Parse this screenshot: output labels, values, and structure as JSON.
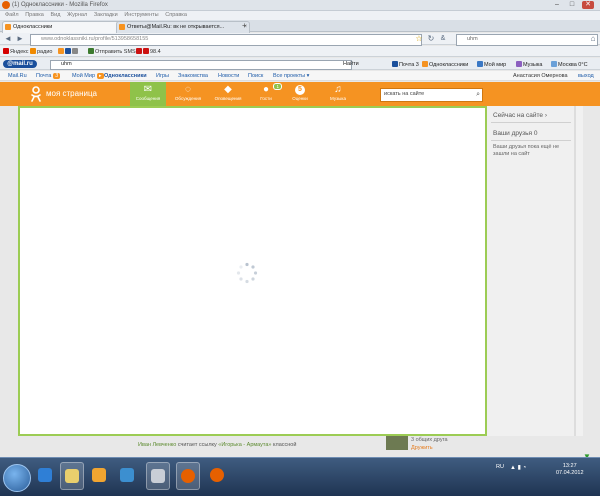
{
  "window": {
    "title": "(1) Одноклассники - Mozilla Firefox",
    "min_glyph": "–",
    "max_glyph": "□",
    "close_glyph": "✕"
  },
  "menu": [
    "Файл",
    "Правка",
    "Вид",
    "Журнал",
    "Закладки",
    "Инструменты",
    "Справка"
  ],
  "tabs": [
    {
      "label": "Одноклассники",
      "active": true
    },
    {
      "label": "Ответы@Mail.Ru: вк не открывается...",
      "active": false
    }
  ],
  "tab_add": "+",
  "nav": {
    "url": "www.odnoklassniki.ru/profile/513958658155",
    "search_value": "uhm",
    "back": "◄",
    "forward": "►",
    "reload": "↻"
  },
  "bookmarks": [
    {
      "label": "Яндекс",
      "color": "#d40000"
    },
    {
      "label": "радио",
      "color": "#f08a00"
    },
    {
      "label": "Отправить SMS",
      "color": "#3c7a2e"
    },
    {
      "label": "98.4",
      "color": "#c11"
    }
  ],
  "mailru": {
    "logo": "@mail.ru",
    "search_value": "uhm",
    "find": "Найти",
    "mail": "Почта 3",
    "ok": "Одноклассники",
    "myworld": "Мой мир",
    "music": "Музыка",
    "weather": "Москва 0°C"
  },
  "portal": {
    "items": [
      "Mail.Ru",
      "Почта",
      "Мой Мир",
      "Одноклассники",
      "Игры",
      "Знакомства",
      "Новости",
      "Поиск",
      "Все проекты ▾"
    ],
    "mail_count": "3",
    "user": "Анастасия Омернова",
    "logout": "выход"
  },
  "ok": {
    "title": "моя страница",
    "nav": [
      {
        "label": "Сообщения",
        "icon": "✉",
        "active": true,
        "badge": ""
      },
      {
        "label": "Обсуждения",
        "icon": "◌",
        "active": false,
        "badge": ""
      },
      {
        "label": "Оповещения",
        "icon": "◆",
        "active": false,
        "badge": ""
      },
      {
        "label": "Гости",
        "icon": "●",
        "active": false,
        "badge": "1"
      },
      {
        "label": "Оценки",
        "icon": "5",
        "active": false,
        "badge": ""
      },
      {
        "label": "Музыка",
        "icon": "♫",
        "active": false,
        "badge": ""
      }
    ],
    "search_placeholder": "искать на сайте",
    "search_icon": "⌕"
  },
  "sidebar": {
    "now_online": "Сейчас на сайте ›",
    "friends_online": "Ваши друзья 0",
    "no_friends": "Ваши друзья пока ещё не зашли на сайт"
  },
  "feed": {
    "who": "Иван Левченко",
    "text": "считает ссылку",
    "link": "«Игорька - Армаута»",
    "tail": "классной"
  },
  "friend_suggest": {
    "common": "3 общих друга",
    "action": "Дружить"
  },
  "taskbar": {
    "lang": "RU",
    "time": "13:27",
    "date": "07.04.2012"
  }
}
